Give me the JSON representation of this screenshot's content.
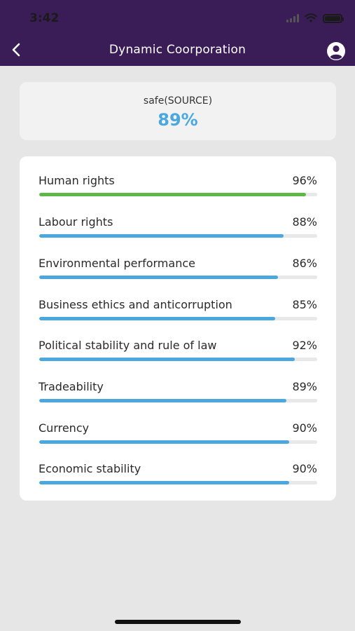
{
  "status_bar": {
    "time": "3:42"
  },
  "header": {
    "title": "Dynamic Coorporation"
  },
  "summary": {
    "label": "safe(SOURCE)",
    "value": "89%"
  },
  "colors": {
    "header_bg": "#3a1d57",
    "accent_blue": "#4aa8df",
    "accent_green": "#5cb947",
    "track": "#e8e8e8"
  },
  "scores": [
    {
      "label": "Human rights",
      "value_text": "96%",
      "percent": 96,
      "color": "#5cb947"
    },
    {
      "label": "Labour rights",
      "value_text": "88%",
      "percent": 88,
      "color": "#4aa8df"
    },
    {
      "label": "Environmental performance",
      "value_text": "86%",
      "percent": 86,
      "color": "#4aa8df"
    },
    {
      "label": "Business ethics and anticorruption",
      "value_text": "85%",
      "percent": 85,
      "color": "#4aa8df"
    },
    {
      "label": "Political stability and rule of law",
      "value_text": "92%",
      "percent": 92,
      "color": "#4aa8df"
    },
    {
      "label": "Tradeability",
      "value_text": "89%",
      "percent": 89,
      "color": "#4aa8df"
    },
    {
      "label": "Currency",
      "value_text": "90%",
      "percent": 90,
      "color": "#4aa8df"
    },
    {
      "label": "Economic stability",
      "value_text": "90%",
      "percent": 90,
      "color": "#4aa8df"
    }
  ]
}
